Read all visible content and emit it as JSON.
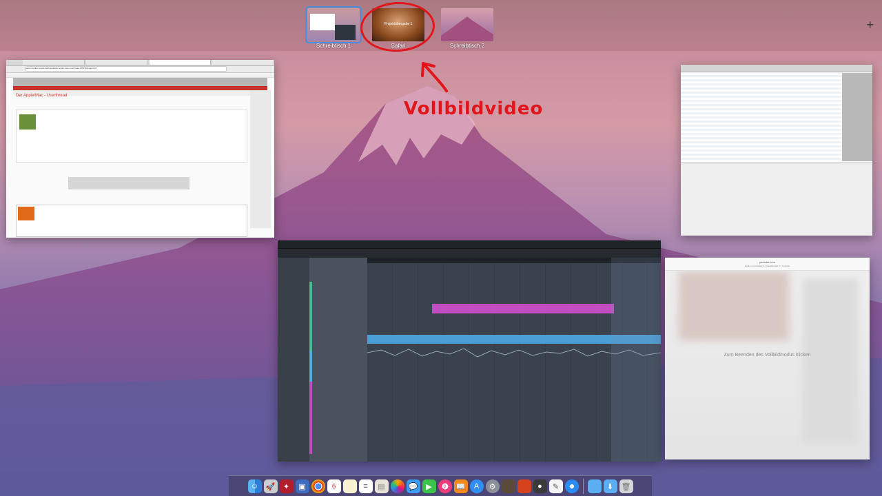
{
  "spaces": [
    {
      "label": "Schreibtisch 1",
      "active": true
    },
    {
      "label": "Safari",
      "active": false,
      "thumb_caption": "Projektübergabe 1"
    },
    {
      "label": "Schreibtisch 2",
      "active": false
    }
  ],
  "add_space_label": "+",
  "annotation": {
    "text": "Vollbildvideo",
    "color": "#e0161b"
  },
  "safari_window": {
    "url": "www.musiker-board.de/threads/der-apple-mac-userthread.278135/page-2117",
    "page_title": "Der Apple/Mac - Userthread"
  },
  "youtube_window": {
    "url": "youtube.com",
    "subtitle": "Fusion mit Cubase 8 - Projektfenster 1 - YouTube",
    "message": "Zum Beenden des Vollbildmodus klicken"
  },
  "dock": {
    "icons": [
      "finder-icon",
      "launchpad-icon",
      "cubase-icon",
      "preview-icon",
      "chrome-icon",
      "calendar-icon",
      "notes-icon",
      "reminders-icon",
      "photo-icon",
      "photos-icon",
      "messages-icon",
      "facetime-icon",
      "itunes-icon",
      "ibooks-icon",
      "appstore-icon",
      "systemprefs-icon",
      "thumbnail-icon",
      "photobooth-icon",
      "garageband-icon",
      "textedit-icon",
      "safari-icon",
      "folder-icon",
      "downloads-icon",
      "trash-icon"
    ]
  }
}
